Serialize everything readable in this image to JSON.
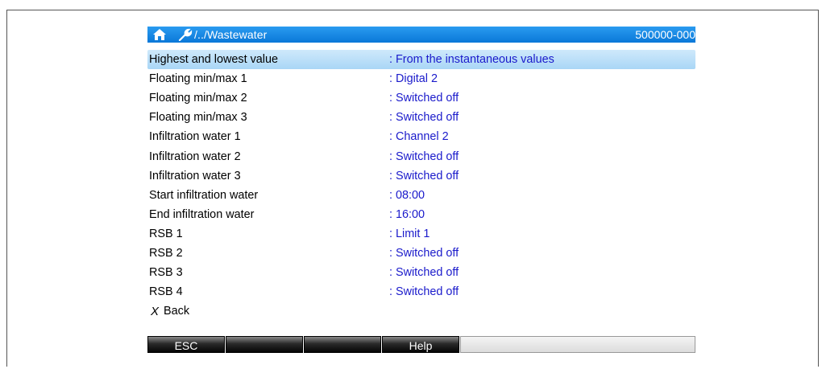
{
  "header": {
    "path": "/../Wastewater",
    "device_id": "500000-000"
  },
  "rows": [
    {
      "label": "Highest and lowest value",
      "value": ": From the instantaneous values",
      "selected": true
    },
    {
      "label": "Floating min/max 1",
      "value": ": Digital 2"
    },
    {
      "label": "Floating min/max 2",
      "value": ": Switched off"
    },
    {
      "label": "Floating min/max 3",
      "value": ": Switched off"
    },
    {
      "label": "Infiltration water 1",
      "value": ": Channel 2"
    },
    {
      "label": "Infiltration water 2",
      "value": ": Switched off"
    },
    {
      "label": "Infiltration water 3",
      "value": ": Switched off"
    },
    {
      "label": "Start infiltration water",
      "value": ": 08:00"
    },
    {
      "label": "End infiltration water",
      "value": ": 16:00"
    },
    {
      "label": "RSB 1",
      "value": ": Limit 1"
    },
    {
      "label": "RSB 2",
      "value": ": Switched off"
    },
    {
      "label": "RSB 3",
      "value": ": Switched off"
    },
    {
      "label": "RSB 4",
      "value": ": Switched off"
    }
  ],
  "back": {
    "symbol": "X",
    "label": "Back"
  },
  "softkeys": [
    "ESC",
    "",
    "",
    "Help"
  ],
  "icons": {
    "home": "home-icon",
    "path": "wrench-icon"
  },
  "colors": {
    "titlebar": "#0a78d8",
    "value_text": "#1a1acb",
    "selection": "#a9d6f6"
  }
}
